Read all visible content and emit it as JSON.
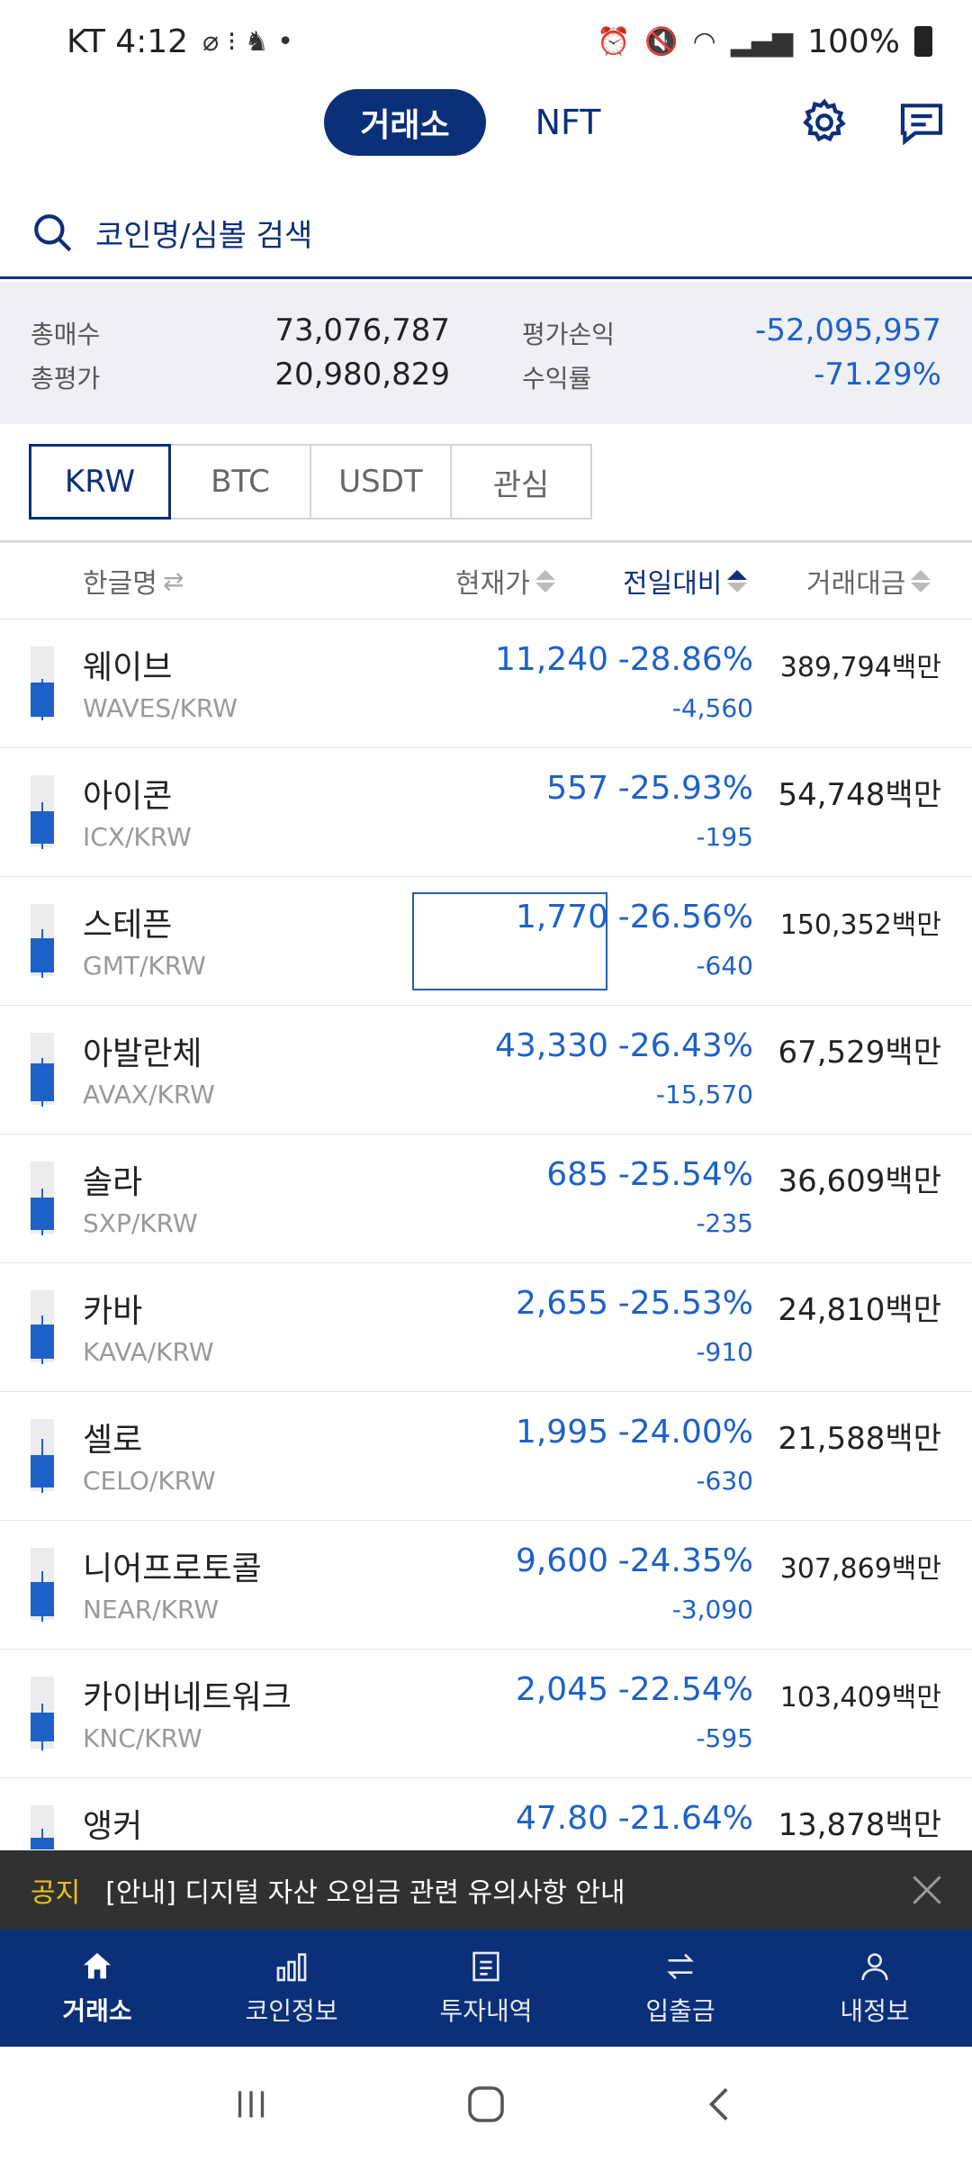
{
  "status_bar": {
    "carrier_time": "KT 4:12",
    "battery": "100%"
  },
  "header": {
    "tabs": [
      {
        "label": "거래소"
      },
      {
        "label": "NFT"
      }
    ],
    "icons": [
      "settings-icon",
      "chat-icon"
    ]
  },
  "search": {
    "placeholder": "코인명/심볼 검색"
  },
  "summary": {
    "total_buy_label": "총매수",
    "total_buy": "73,076,787",
    "total_eval_label": "총평가",
    "total_eval": "20,980,829",
    "pnl_label": "평가손익",
    "pnl": "-52,095,957",
    "return_label": "수익률",
    "return": "-71.29%"
  },
  "market_tabs": [
    {
      "label": "KRW"
    },
    {
      "label": "BTC"
    },
    {
      "label": "USDT"
    },
    {
      "label": "관심"
    }
  ],
  "table_header": {
    "name": "한글명",
    "price": "현재가",
    "change": "전일대비",
    "volume": "거래대금"
  },
  "rows": [
    {
      "name": "웨이브",
      "symbol": "WAVES/KRW",
      "price": "11,240",
      "rate": "-28.86%",
      "change": "-4,560",
      "volume": "389,794백만"
    },
    {
      "name": "아이콘",
      "symbol": "ICX/KRW",
      "price": "557",
      "rate": "-25.93%",
      "change": "-195",
      "volume": "54,748백만"
    },
    {
      "name": "스테픈",
      "symbol": "GMT/KRW",
      "price": "1,770",
      "rate": "-26.56%",
      "change": "-640",
      "volume": "150,352백만"
    },
    {
      "name": "아발란체",
      "symbol": "AVAX/KRW",
      "price": "43,330",
      "rate": "-26.43%",
      "change": "-15,570",
      "volume": "67,529백만"
    },
    {
      "name": "솔라",
      "symbol": "SXP/KRW",
      "price": "685",
      "rate": "-25.54%",
      "change": "-235",
      "volume": "36,609백만"
    },
    {
      "name": "카바",
      "symbol": "KAVA/KRW",
      "price": "2,655",
      "rate": "-25.53%",
      "change": "-910",
      "volume": "24,810백만"
    },
    {
      "name": "셀로",
      "symbol": "CELO/KRW",
      "price": "1,995",
      "rate": "-24.00%",
      "change": "-630",
      "volume": "21,588백만"
    },
    {
      "name": "니어프로토콜",
      "symbol": "NEAR/KRW",
      "price": "9,600",
      "rate": "-24.35%",
      "change": "-3,090",
      "volume": "307,869백만"
    },
    {
      "name": "카이버네트워크",
      "symbol": "KNC/KRW",
      "price": "2,045",
      "rate": "-22.54%",
      "change": "-595",
      "volume": "103,409백만"
    },
    {
      "name": "앵커",
      "symbol": "",
      "price": "47.80",
      "rate": "-21.64%",
      "change": "",
      "volume": "13,878백만"
    }
  ],
  "notice": {
    "tag": "공지",
    "text": "[안내] 디지털 자산 오입금 관련 유의사항 안내"
  },
  "bottom_nav": [
    {
      "label": "거래소",
      "icon": "home-icon"
    },
    {
      "label": "코인정보",
      "icon": "chart-icon"
    },
    {
      "label": "투자내역",
      "icon": "document-icon"
    },
    {
      "label": "입출금",
      "icon": "transfer-icon"
    },
    {
      "label": "내정보",
      "icon": "user-icon"
    }
  ],
  "colors": {
    "brand": "#0c2f79",
    "down": "#1d61c8",
    "notice_tag": "#f3c315"
  }
}
